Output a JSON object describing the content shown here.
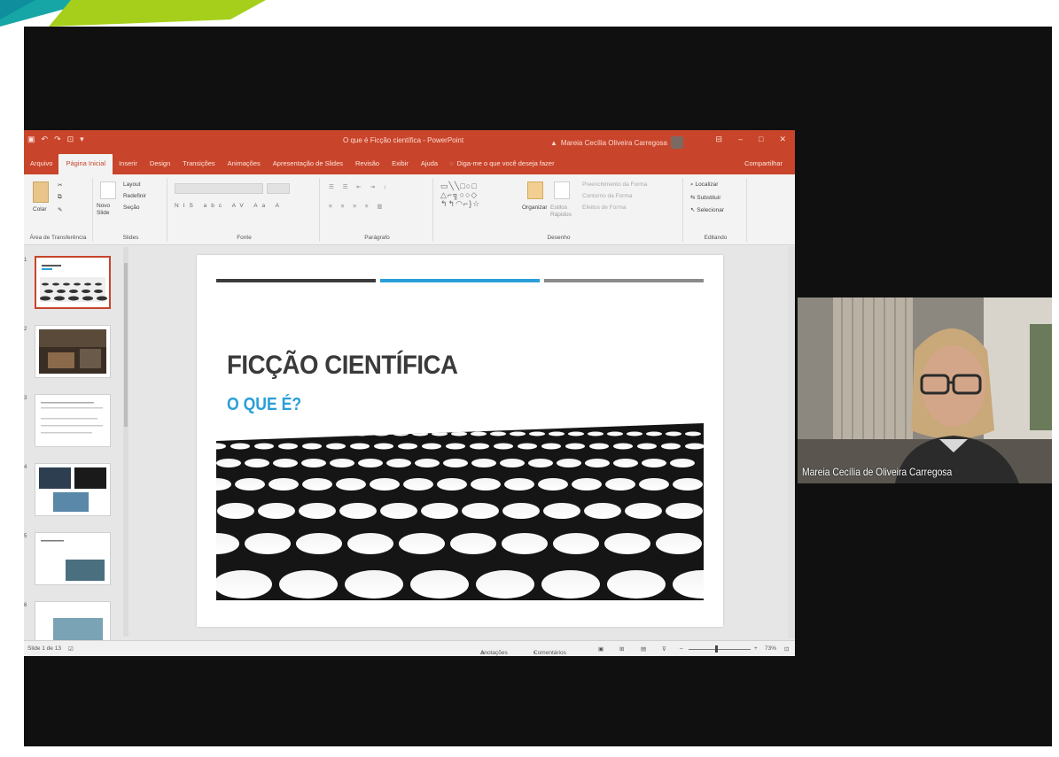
{
  "titlebar": {
    "qat_icons": [
      "save-icon",
      "undo-icon",
      "redo-icon",
      "present-icon"
    ],
    "doc_title": "O que é Ficção científica - PowerPoint",
    "user_name": "Mareia Cecília Oliveira Carregosa",
    "window_controls": [
      "ribbon-display-icon",
      "minimize-icon",
      "maximize-icon",
      "close-icon"
    ]
  },
  "tabs": [
    {
      "label": "Arquivo"
    },
    {
      "label": "Página Inicial"
    },
    {
      "label": "Inserir"
    },
    {
      "label": "Design"
    },
    {
      "label": "Transições"
    },
    {
      "label": "Animações"
    },
    {
      "label": "Apresentação de Slides"
    },
    {
      "label": "Revisão"
    },
    {
      "label": "Exibir"
    },
    {
      "label": "Ajuda"
    }
  ],
  "tellme": "Diga-me o que você deseja fazer",
  "share": "Compartilhar",
  "ribbon": {
    "clipboard": {
      "paste": "Colar",
      "label": "Área de Transferência"
    },
    "slides": {
      "new_slide": "Novo Slide",
      "layout": "Layout",
      "reset": "Redefinir",
      "section": "Seção",
      "label": "Slides"
    },
    "font": {
      "label": "Fonte"
    },
    "paragraph": {
      "label": "Parágrafo"
    },
    "drawing": {
      "arrange": "Organizar",
      "quick_styles": "Estilos Rápidos",
      "fill": "Preenchimento da Forma",
      "outline": "Contorno da Forma",
      "effects": "Efeitos de Forma",
      "label": "Desenho"
    },
    "editing": {
      "find": "Localizar",
      "replace": "Substituir",
      "select": "Selecionar",
      "label": "Editando"
    }
  },
  "slide": {
    "title": "FICÇÃO CIENTÍFICA",
    "subtitle": "O QUE É?"
  },
  "statusbar": {
    "slide_count": "Slide 1 de 13",
    "notes": "Anotações",
    "comments": "Comentários",
    "zoom": "73%"
  },
  "video": {
    "participant_name": "Mareia Cecília de Oliveira Carregosa"
  },
  "colors": {
    "ppt_accent": "#c8452b",
    "slide_blue": "#2a9ed8",
    "slide_title": "#3a3a3a"
  }
}
